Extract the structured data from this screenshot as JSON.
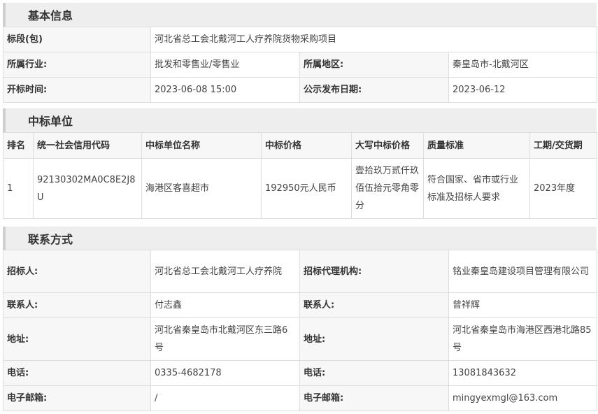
{
  "basic": {
    "title": "基本信息",
    "section_label": "标段(包)",
    "section_value": "河北省总工会北戴河工人疗养院货物采购项目",
    "industry_label": "所属行业:",
    "industry_value": "批发和零售业/零售业",
    "region_label": "所属地区:",
    "region_value": "秦皇岛市-北戴河区",
    "open_label": "开标时间:",
    "open_value": "2023-06-08 15:00",
    "publish_label": "公示发布日期:",
    "publish_value": "2023-06-12"
  },
  "winner": {
    "title": "中标单位",
    "headers": [
      "排名",
      "统一社会信用代码",
      "中标单位名称",
      "中标价格",
      "大写中标价格",
      "质量标准",
      "工期/交货期"
    ],
    "row": [
      "1",
      "92130302MA0C8E2J8U",
      "海港区客喜超市",
      "192950元人民币",
      "壹拾玖万贰仟玖佰伍拾元零角零分",
      "符合国家、省市或行业标准及招标人要求",
      "2023年度"
    ]
  },
  "contact": {
    "title": "联系方式",
    "tenderer_label": "招标人:",
    "tenderer_value": "河北省总工会北戴河工人疗养院",
    "agency_label": "招标代理机构:",
    "agency_value": "铭业秦皇岛建设项目管理有限公司",
    "person_label": "联系人:",
    "person_value": "付志鑫",
    "person2_label": "联系人:",
    "person2_value": "曾祥辉",
    "addr_label": "地址:",
    "addr_value": "河北省秦皇岛市北戴河区东三路6号",
    "addr2_label": "地址:",
    "addr2_value": "河北省秦皇岛市海港区西港北路85号",
    "phone_label": "电话:",
    "phone_value": "0335-4682178",
    "phone2_label": "电话:",
    "phone2_value": "13081843632",
    "email_label": "电子邮箱:",
    "email_value": "/",
    "email2_label": "电子邮箱:",
    "email2_value": "mingyexmgl@163.com"
  }
}
